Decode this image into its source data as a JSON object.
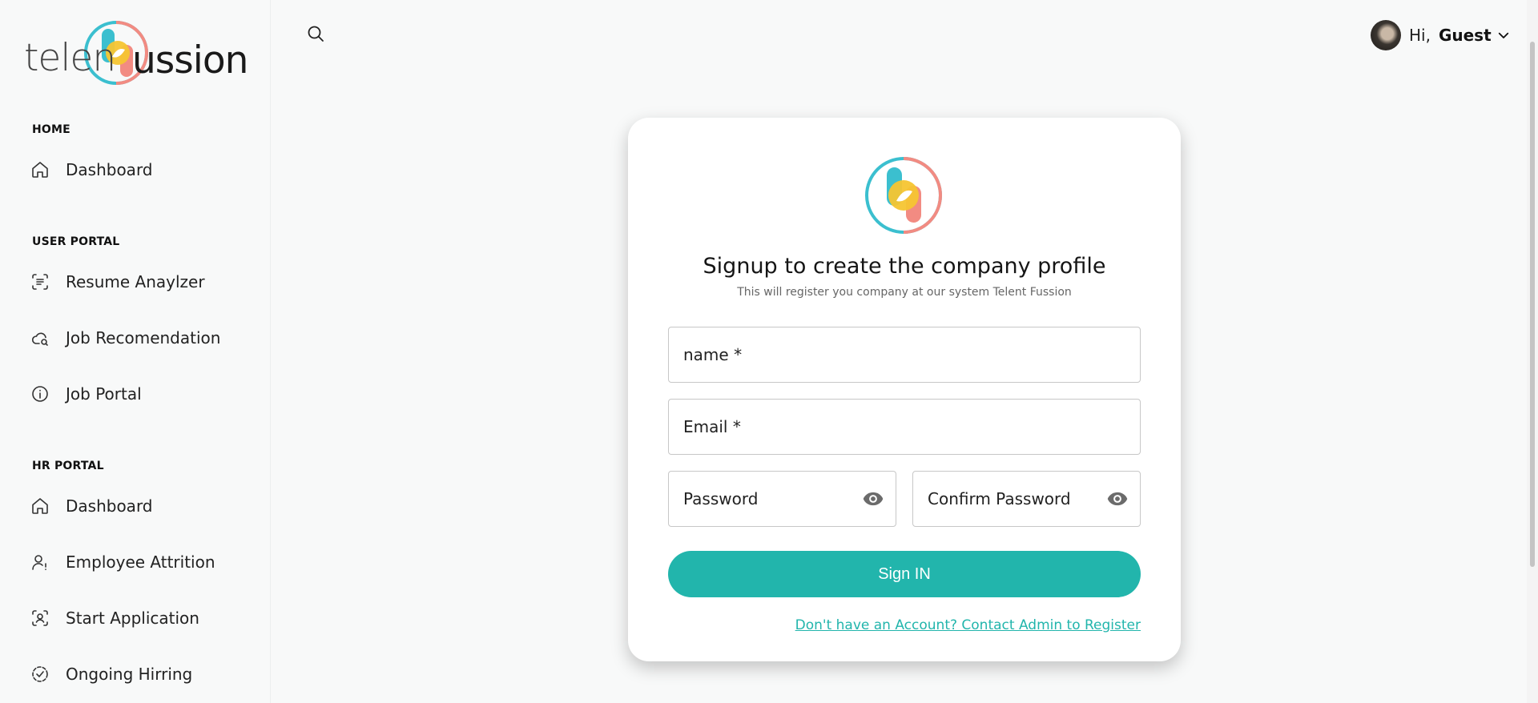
{
  "brand": {
    "logo_text_left": "telen",
    "logo_text_right": "ussion",
    "colors": {
      "teal": "#3bbfcf",
      "yellow": "#f5c531",
      "coral": "#f28b82",
      "accent": "#22b5ac"
    }
  },
  "sidebar": {
    "sections": [
      {
        "title": "HOME",
        "items": [
          {
            "label": "Dashboard",
            "icon": "home-icon"
          }
        ]
      },
      {
        "title": "USER PORTAL",
        "items": [
          {
            "label": "Resume Anaylzer",
            "icon": "scan-text-icon"
          },
          {
            "label": "Job Recomendation",
            "icon": "cloud-search-icon"
          },
          {
            "label": "Job Portal",
            "icon": "info-icon"
          }
        ]
      },
      {
        "title": "HR PORTAL",
        "items": [
          {
            "label": "Dashboard",
            "icon": "home-icon"
          },
          {
            "label": "Employee Attrition",
            "icon": "user-alert-icon"
          },
          {
            "label": "Start Application",
            "icon": "scan-user-icon"
          },
          {
            "label": "Ongoing Hirring",
            "icon": "circle-check-dashed-icon"
          }
        ]
      }
    ]
  },
  "header": {
    "search_icon": "search-icon",
    "greeting": "Hi,",
    "username": "Guest"
  },
  "form": {
    "title": "Signup to create the company profile",
    "subtitle": "This will register you company at our system Telent Fussion",
    "name_label": "name *",
    "email_label": "Email *",
    "password_label": "Password",
    "confirm_label": "Confirm Password",
    "submit_label": "Sign IN",
    "register_link": "Don't have an Account? Contact Admin to Register"
  }
}
